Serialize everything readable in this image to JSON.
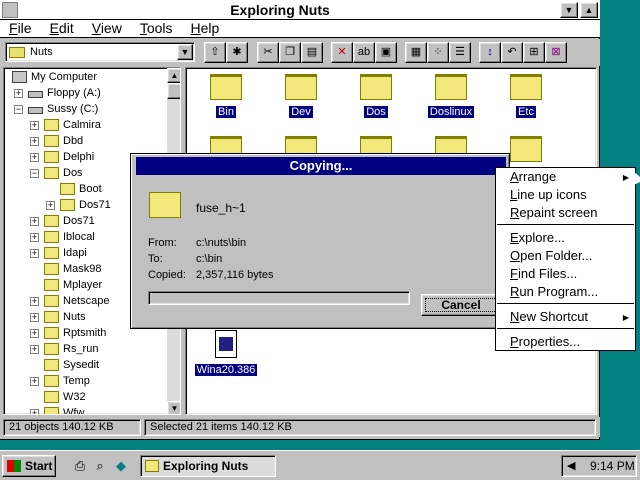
{
  "window": {
    "title": "Exploring Nuts",
    "minimize_glyph": "▼",
    "maximize_glyph": "▲"
  },
  "menubar": [
    "File",
    "Edit",
    "View",
    "Tools",
    "Help"
  ],
  "toolbar": {
    "address_value": "Nuts",
    "buttons": [
      "up-folder",
      "new-folder",
      "cut",
      "copy",
      "paste",
      "delete",
      "rename",
      "properties",
      "large-icons",
      "small-icons",
      "list",
      "details",
      "sort",
      "undo",
      "map-drive",
      "disconnect"
    ]
  },
  "tree": [
    {
      "label": "My Computer",
      "level": 0,
      "expander": "",
      "icon": "pc"
    },
    {
      "label": "Floppy (A:)",
      "level": 1,
      "expander": "+",
      "icon": "drive"
    },
    {
      "label": "Sussy (C:)",
      "level": 1,
      "expander": "−",
      "icon": "drive"
    },
    {
      "label": "Calmira",
      "level": 2,
      "expander": "+",
      "icon": "folder"
    },
    {
      "label": "Dbd",
      "level": 2,
      "expander": "+",
      "icon": "folder"
    },
    {
      "label": "Delphi",
      "level": 2,
      "expander": "+",
      "icon": "folder"
    },
    {
      "label": "Dos",
      "level": 2,
      "expander": "−",
      "icon": "folder"
    },
    {
      "label": "Boot",
      "level": 3,
      "expander": "",
      "icon": "folder"
    },
    {
      "label": "Dos71",
      "level": 3,
      "expander": "+",
      "icon": "folder"
    },
    {
      "label": "Dos71",
      "level": 2,
      "expander": "+",
      "icon": "folder"
    },
    {
      "label": "Iblocal",
      "level": 2,
      "expander": "+",
      "icon": "folder"
    },
    {
      "label": "Idapi",
      "level": 2,
      "expander": "+",
      "icon": "folder"
    },
    {
      "label": "Mask98",
      "level": 2,
      "expander": "",
      "icon": "folder"
    },
    {
      "label": "Mplayer",
      "level": 2,
      "expander": "",
      "icon": "folder"
    },
    {
      "label": "Netscape",
      "level": 2,
      "expander": "+",
      "icon": "folder"
    },
    {
      "label": "Nuts",
      "level": 2,
      "expander": "+",
      "icon": "folder"
    },
    {
      "label": "Rptsmith",
      "level": 2,
      "expander": "+",
      "icon": "folder"
    },
    {
      "label": "Rs_run",
      "level": 2,
      "expander": "+",
      "icon": "folder"
    },
    {
      "label": "Sysedit",
      "level": 2,
      "expander": "",
      "icon": "folder"
    },
    {
      "label": "Temp",
      "level": 2,
      "expander": "+",
      "icon": "folder"
    },
    {
      "label": "W32",
      "level": 2,
      "expander": "",
      "icon": "folder"
    },
    {
      "label": "Wfw",
      "level": 2,
      "expander": "+",
      "icon": "folder"
    }
  ],
  "content_items": [
    {
      "label": "Bin",
      "kind": "folder"
    },
    {
      "label": "Dev",
      "kind": "folder"
    },
    {
      "label": "Dos",
      "kind": "folder"
    },
    {
      "label": "Doslinux",
      "kind": "folder"
    },
    {
      "label": "Etc",
      "kind": "folder"
    },
    {
      "label": "",
      "kind": "folder"
    },
    {
      "label": "",
      "kind": "folder"
    },
    {
      "label": "",
      "kind": "folder"
    },
    {
      "label": "",
      "kind": "folder"
    },
    {
      "label": "",
      "kind": "folder"
    },
    {
      "label": "Wina20.386",
      "kind": "file"
    }
  ],
  "status": {
    "left": "21 objects  140.12 KB",
    "right": "Selected 21 items  140.12 KB"
  },
  "dialog": {
    "title": "Copying...",
    "filename": "fuse_h~1",
    "from_label": "From:",
    "from_value": "c:\\nuts\\bin",
    "to_label": "To:",
    "to_value": "c:\\bin",
    "copied_label": "Copied:",
    "copied_value": "2,357,116 bytes",
    "progress": 0,
    "cancel_label": "Cancel"
  },
  "context_menu": {
    "items": [
      {
        "label": "Arrange",
        "submenu": true
      },
      {
        "label": "Line up icons",
        "submenu": false
      },
      {
        "label": "Repaint screen",
        "submenu": false
      },
      {
        "label": "Explore...",
        "submenu": false
      },
      {
        "label": "Open Folder...",
        "submenu": false
      },
      {
        "label": "Find Files...",
        "submenu": false
      },
      {
        "label": "Run Program...",
        "submenu": false
      },
      {
        "label": "New Shortcut",
        "submenu": true
      },
      {
        "label": "Properties...",
        "submenu": false
      }
    ]
  },
  "taskbar": {
    "start_label": "Start",
    "task_label": "Exploring Nuts",
    "clock": "9:14 PM"
  },
  "colors": {
    "desktop": "#008080",
    "selection": "#000080",
    "folder": "#f2e77a"
  }
}
